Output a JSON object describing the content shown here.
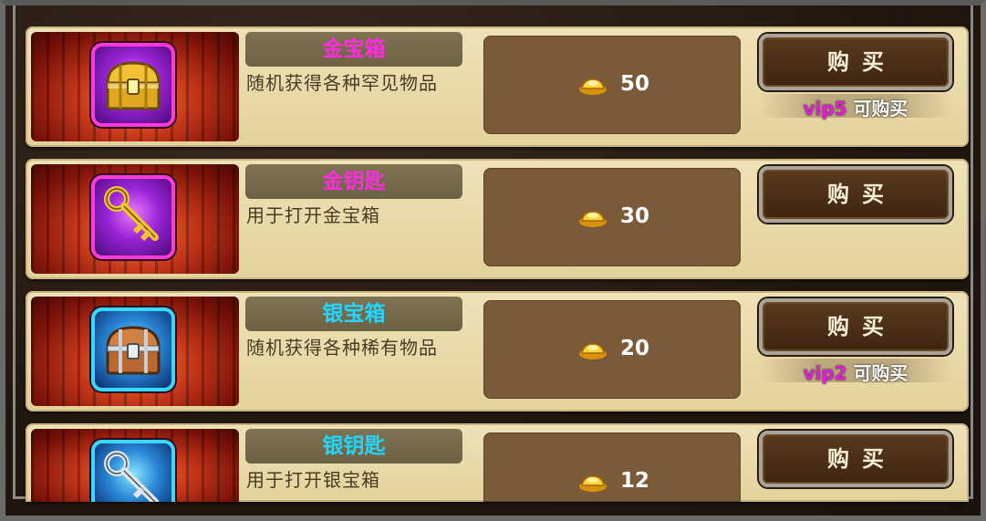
{
  "shop": {
    "items": [
      {
        "name": "金宝箱",
        "description": "随机获得各种罕见物品",
        "price": "50",
        "buy_label": "购买",
        "vip_level": "vip5",
        "vip_text": "可购买",
        "icon": "gold-chest-icon",
        "title_color": "#ff2ce0"
      },
      {
        "name": "金钥匙",
        "description": "用于打开金宝箱",
        "price": "30",
        "buy_label": "购买",
        "icon": "gold-key-icon",
        "title_color": "#ff2ce0"
      },
      {
        "name": "银宝箱",
        "description": "随机获得各种稀有物品",
        "price": "20",
        "buy_label": "购买",
        "vip_level": "vip2",
        "vip_text": "可购买",
        "icon": "silver-chest-icon",
        "title_color": "#22d6ff"
      },
      {
        "name": "银钥匙",
        "description": "用于打开银宝箱",
        "price": "12",
        "buy_label": "购买",
        "icon": "silver-key-icon",
        "title_color": "#22d6ff"
      }
    ],
    "currency_icon": "gold-ingot-icon"
  }
}
